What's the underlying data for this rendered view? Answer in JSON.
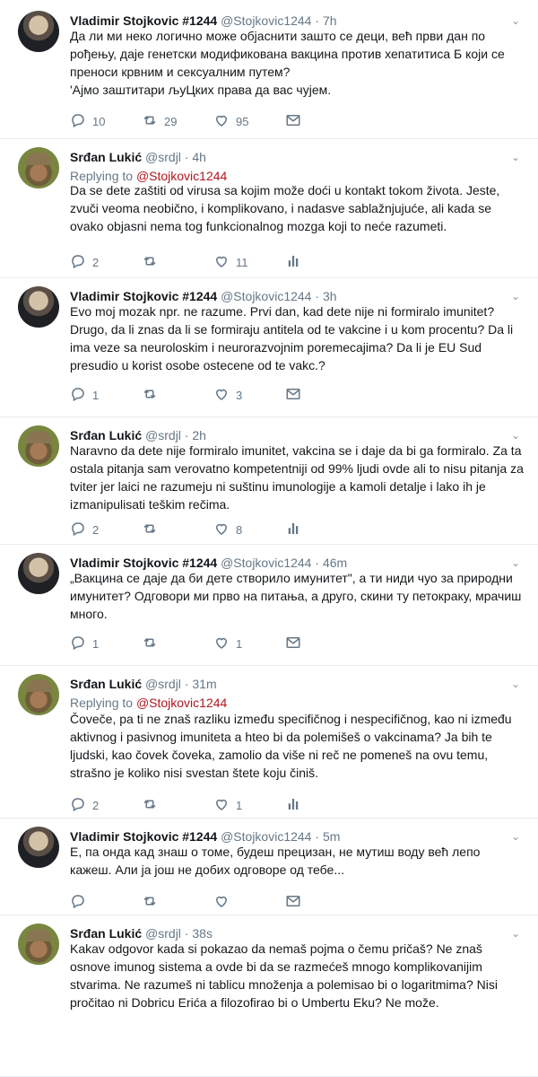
{
  "tweets": [
    {
      "name": "Vladimir Stojkovic #1244",
      "handle": "@Stojkovic1244",
      "time": "7h",
      "reply_to_label": "",
      "reply_to": "",
      "text": "Да ли ми неко логично може објаснити зашто се деци, већ први дан по рођењу, даје генетски модификована вакцина против хепатитиса Б који се преноси крвним и сексуалним путем?\n'Ајмо заштитари љуЦких права да вас чујем.",
      "replies": "10",
      "retweets": "29",
      "likes": "95",
      "extra_icon": "mail-icon"
    },
    {
      "name": "Srđan Lukić",
      "handle": "@srdjl",
      "time": "4h",
      "reply_to_label": "Replying to ",
      "reply_to": "@Stojkovic1244",
      "text": "Da se dete zaštiti od virusa sa kojim može doći u kontakt tokom života. Jeste, zvuči veoma neobično, i komplikovano, i nadasve sablažnjujuće, ali kada se ovako objasni nema tog funkcionalnog mozga koji to neće razumeti.",
      "replies": "2",
      "retweets": "",
      "likes": "11",
      "extra_icon": "analytics-icon"
    },
    {
      "name": "Vladimir Stojkovic #1244",
      "handle": "@Stojkovic1244",
      "time": "3h",
      "reply_to_label": "",
      "reply_to": "",
      "text": "Evo moj mozak npr. ne razume. Prvi dan, kad dete nije ni formiralo imunitet? Drugo, da li znas da li se formiraju antitela od te vakcine i u kom procentu? Da li ima veze sa neuroloskim i neurorazvojnim poremecajima? Da li je EU Sud presudio u korist osobe ostecene od te vakc.?",
      "replies": "1",
      "retweets": "",
      "likes": "3",
      "extra_icon": "mail-icon"
    },
    {
      "name": "Srđan Lukić",
      "handle": "@srdjl",
      "time": "2h",
      "reply_to_label": "",
      "reply_to": "",
      "text": "Naravno da dete nije formiralo imunitet, vakcina se i daje da bi ga formiralo. Za ta ostala pitanja sam verovatno kompetentniji od 99% ljudi ovde ali to nisu pitanja za tviter jer laici ne razumeju ni suštinu imunologije a kamoli detalje i lako ih je izmanipulisati teškim rečima.",
      "replies": "2",
      "retweets": "",
      "likes": "8",
      "extra_icon": "analytics-icon"
    },
    {
      "name": "Vladimir Stojkovic #1244",
      "handle": "@Stojkovic1244",
      "time": "46m",
      "reply_to_label": "",
      "reply_to": "",
      "text": "„Вакцина се даје да би дете створило имунитет\", а ти ниди чуо за природни имунитет? Одговори ми прво на питања, а друго, скини ту петокраку, мрачиш много.",
      "replies": "1",
      "retweets": "",
      "likes": "1",
      "extra_icon": "mail-icon"
    },
    {
      "name": "Srđan Lukić",
      "handle": "@srdjl",
      "time": "31m",
      "reply_to_label": "Replying to ",
      "reply_to": "@Stojkovic1244",
      "text": "Čoveče, pa ti ne znaš razliku između specifičnog i nespecifičnog, kao ni između aktivnog i pasivnog imuniteta a hteo bi da polemišeš o vakcinama? Ja bih te ljudski, kao čovek čoveka, zamolio da više ni reč ne pomeneš na ovu temu, strašno je koliko nisi svestan štete koju činiš.",
      "replies": "2",
      "retweets": "",
      "likes": "1",
      "extra_icon": "analytics-icon"
    },
    {
      "name": "Vladimir Stojkovic #1244",
      "handle": "@Stojkovic1244",
      "time": "5m",
      "reply_to_label": "",
      "reply_to": "",
      "text": "Е, па онда кад знаш о томе, будеш прецизан, не мутиш воду већ лепо кажеш. Али ја још не добих одговоре од тебе...",
      "replies": "",
      "retweets": "",
      "likes": "",
      "extra_icon": "mail-icon"
    },
    {
      "name": "Srđan Lukić",
      "handle": "@srdjl",
      "time": "38s",
      "reply_to_label": "",
      "reply_to": "",
      "text": "Kakav odgovor kada si pokazao da nemaš pojma o čemu pričaš? Ne znaš osnove imunog sistema a ovde bi da se razmećeš mnogo komplikovanijim stvarima. Ne razumeš ni tablicu množenja a polemisao bi o logaritmima? Nisi pročitao ni Dobricu Erića a filozofirao bi o Umbertu Eku? Ne može.",
      "replies": "",
      "retweets": "",
      "likes": "",
      "extra_icon": "none"
    }
  ],
  "labels": {
    "dot": "·",
    "chevron": "⌄"
  }
}
